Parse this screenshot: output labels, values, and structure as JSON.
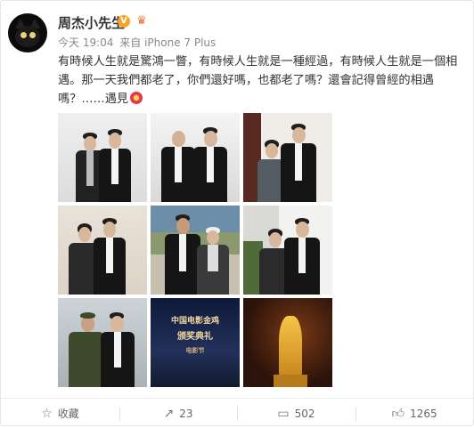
{
  "post": {
    "author": "周杰小先生",
    "verified_badge": "V",
    "time": "今天 19:04",
    "via": "来自",
    "device": "iPhone 7 Plus",
    "text": "有時候人生就是驚鴻一瞥，有時候人生就是一種經過，有時候人生就是一個相遇。那一天我們都老了，你們還好嗎，也都老了嗎？還會記得曾經的相遇嗎？……遇見"
  },
  "photos": [
    {
      "name": "photo-1"
    },
    {
      "name": "photo-2"
    },
    {
      "name": "photo-3"
    },
    {
      "name": "photo-4"
    },
    {
      "name": "photo-5"
    },
    {
      "name": "photo-6"
    },
    {
      "name": "photo-7"
    },
    {
      "name": "photo-8"
    },
    {
      "name": "photo-9"
    }
  ],
  "actions": {
    "favorite_label": "收藏",
    "repost_count": "23",
    "comment_count": "502",
    "like_count": "1265"
  },
  "icons": {
    "favorite": "star-icon",
    "repost": "repost-icon",
    "comment": "comment-icon",
    "like": "thumbs-up-icon"
  },
  "colors": {
    "accent": "#f6a623",
    "text": "#333333",
    "meta": "#888888"
  }
}
